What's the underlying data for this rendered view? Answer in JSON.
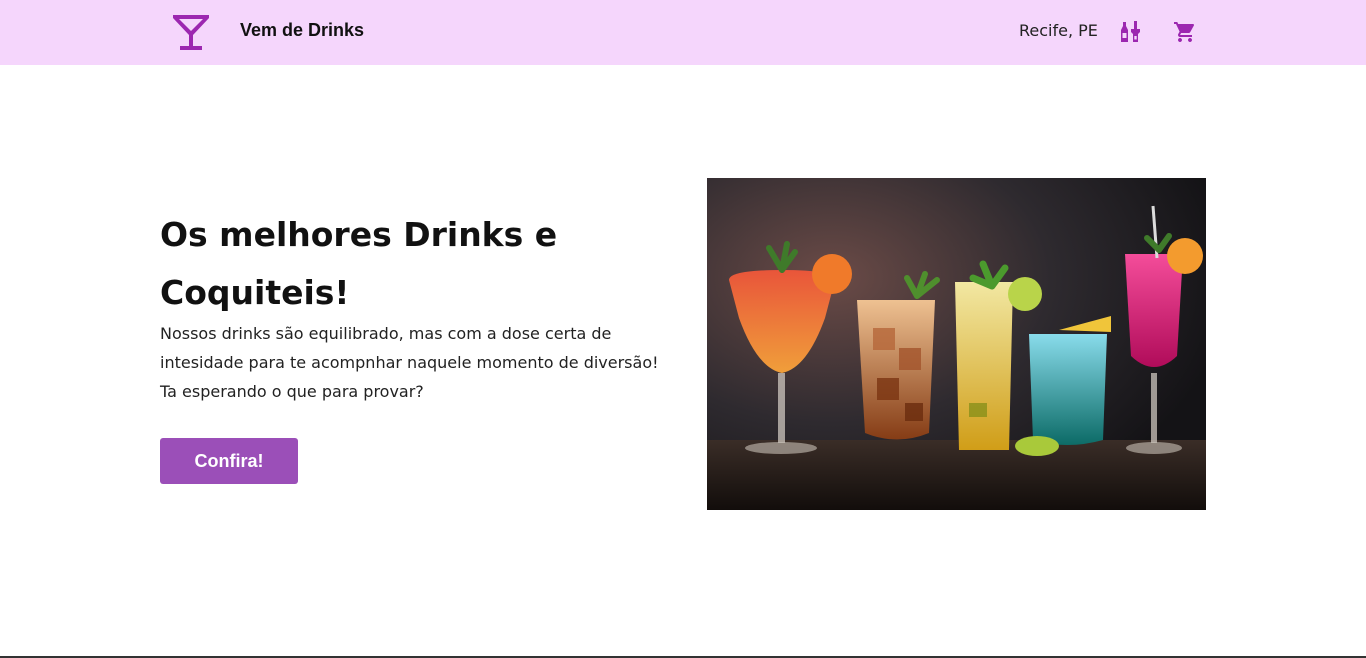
{
  "header": {
    "brand": "Vem de Drinks",
    "location": "Recife, PE",
    "icons": {
      "logo": "cocktail-glass-icon",
      "bottles": "liquor-bottles-icon",
      "cart": "shopping-cart-icon"
    }
  },
  "hero": {
    "title": "Os melhores Drinks e Coquiteis!",
    "description": "Nossos drinks são equilibrado, mas com a dose certa de intesidade para te acompnhar naquele momento de diversão! Ta esperando o que para provar?",
    "cta_label": "Confira!",
    "image": "five colorful cocktails on a dark bar counter"
  },
  "colors": {
    "header_bg": "#f5d6fc",
    "accent": "#9b4fb8",
    "icon": "#9c27b0"
  }
}
